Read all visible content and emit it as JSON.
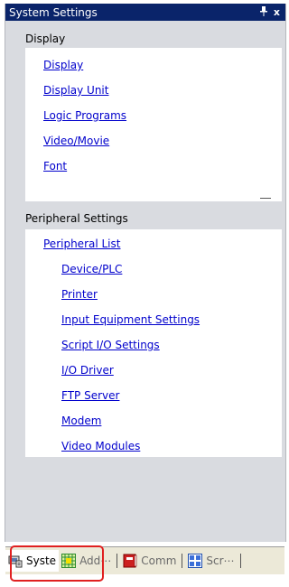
{
  "window": {
    "title": "System Settings",
    "pin": "⮋",
    "close": "x"
  },
  "display_section": {
    "header": "Display",
    "links": [
      "Display",
      "Display Unit",
      "Logic Programs",
      "Video/Movie",
      "Font"
    ]
  },
  "peripheral_section": {
    "header": "Peripheral Settings",
    "parent_link": "Peripheral List",
    "links": [
      "Device/PLC",
      "Printer",
      "Input Equipment Settings",
      "Script I/O Settings",
      "I/O Driver",
      "FTP Server",
      "Modem",
      "Video Modules"
    ]
  },
  "tabs": [
    {
      "label": "Syste",
      "icon": "system-settings-icon",
      "active": true
    },
    {
      "label": "Add⋯",
      "icon": "address-grid-icon",
      "active": false
    },
    {
      "label": "Comm",
      "icon": "comment-book-icon",
      "active": false
    },
    {
      "label": "Scr⋯",
      "icon": "screen-list-icon",
      "active": false
    }
  ],
  "colors": {
    "title_bar": "#0a246a",
    "link": "#0000cc",
    "highlight": "#e02020",
    "panel": "#d9dbe0"
  }
}
